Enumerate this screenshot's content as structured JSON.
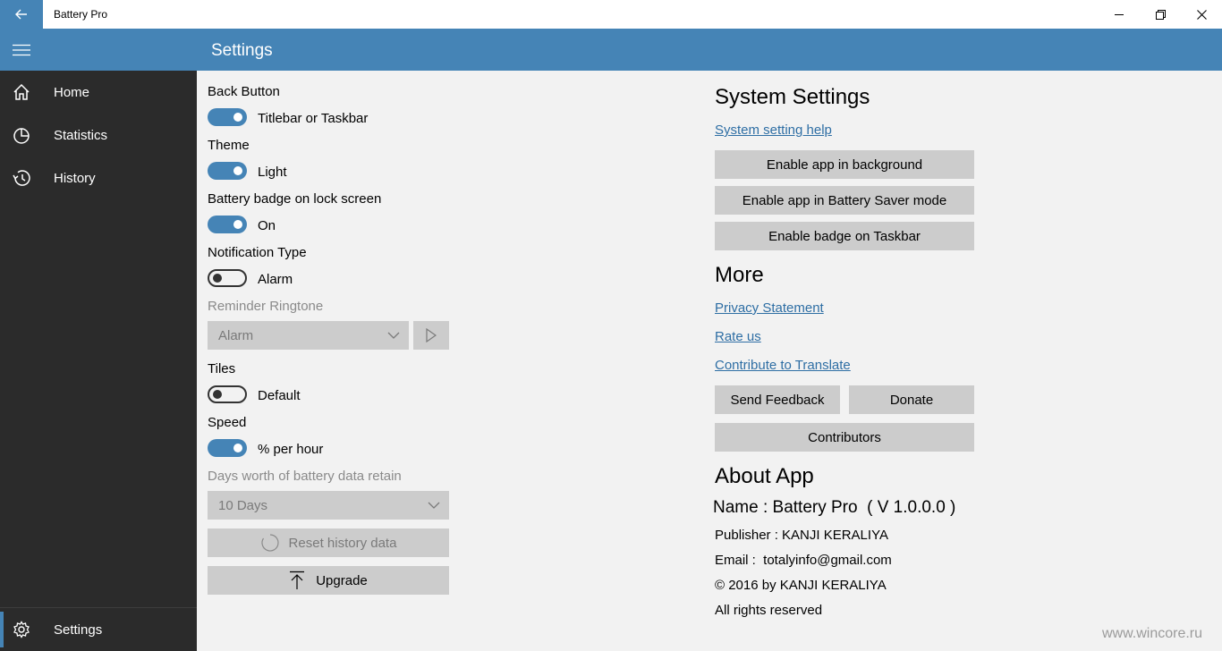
{
  "titlebar": {
    "app_title": "Battery Pro",
    "icons": [
      "back-arrow-icon",
      "minimize-icon",
      "restore-icon",
      "close-icon"
    ]
  },
  "header": {
    "page_title": "Settings"
  },
  "sidebar": {
    "items": [
      {
        "label": "Home",
        "icon": "home-icon"
      },
      {
        "label": "Statistics",
        "icon": "pie-chart-icon"
      },
      {
        "label": "History",
        "icon": "history-icon"
      }
    ],
    "settings_label": "Settings"
  },
  "settings": {
    "back_button": {
      "label": "Back Button",
      "value": "Titlebar or Taskbar",
      "on": true
    },
    "theme": {
      "label": "Theme",
      "value": "Light",
      "on": true
    },
    "badge": {
      "label": "Battery badge on lock screen",
      "value": "On",
      "on": true
    },
    "notification": {
      "label": "Notification Type",
      "value": "Alarm",
      "on": false
    },
    "ringtone": {
      "label": "Reminder Ringtone",
      "selected": "Alarm"
    },
    "tiles": {
      "label": "Tiles",
      "value": "Default",
      "on": false
    },
    "speed": {
      "label": "Speed",
      "value": "% per hour",
      "on": true
    },
    "retain": {
      "label": "Days worth of battery data retain",
      "selected": "10 Days"
    },
    "reset_label": "Reset history data",
    "upgrade_label": "Upgrade"
  },
  "system": {
    "heading": "System Settings",
    "help_link": "System setting help",
    "buttons": [
      "Enable app in background",
      "Enable app in Battery Saver mode",
      "Enable badge on Taskbar"
    ]
  },
  "more": {
    "heading": "More",
    "links": [
      "Privacy Statement",
      "Rate us",
      "Contribute to Translate"
    ],
    "feedback_label": "Send Feedback",
    "donate_label": "Donate",
    "contributors_label": "Contributors"
  },
  "about": {
    "heading": "About App",
    "name": "Name : Battery Pro  ( V 1.0.0.0 )",
    "publisher": "Publisher : KANJI KERALIYA",
    "email": "Email :  totalyinfo@gmail.com",
    "copyright": "© 2016 by KANJI KERALIYA",
    "rights": "All rights reserved"
  },
  "watermark": "www.wincore.ru",
  "colors": {
    "accent": "#4584b6",
    "sidebar": "#2b2b2b",
    "button": "#cccccc",
    "link": "#2e6ea4"
  }
}
